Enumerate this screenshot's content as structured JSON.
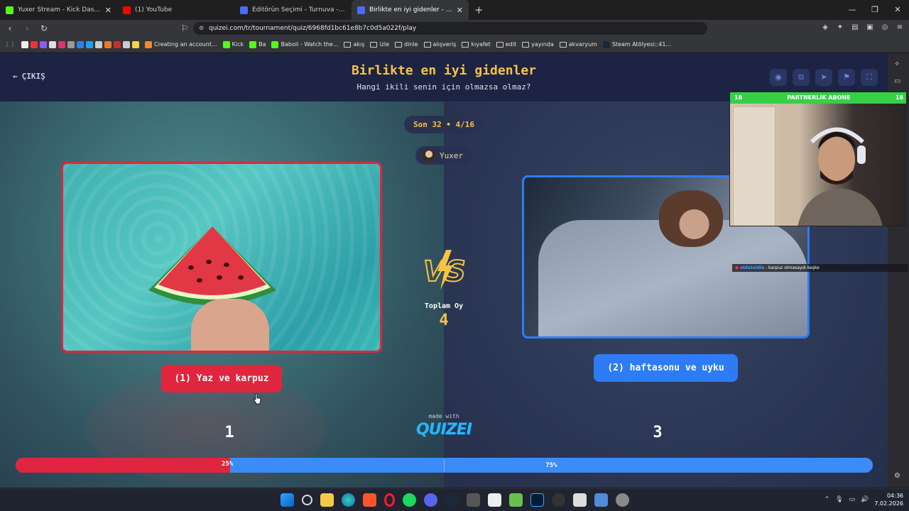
{
  "browser": {
    "tabs": [
      {
        "title": "Yuxer Stream - Kick Dashboard",
        "color": "#53fc18"
      },
      {
        "title": "(1) YouTube",
        "color": "#ff0000"
      },
      {
        "title": "Editörün Seçimi - Turnuva - Quizei",
        "color": "#4a6cf7"
      },
      {
        "title": "Birlikte en iyi gidenler - Tier List...",
        "color": "#4a6cf7",
        "active": true
      }
    ],
    "url": "quizei.com/tr/tournament/quiz/6968fd1bc61e8b7c0d5a022f/play",
    "bookmarks": [
      "Creating an account...",
      "Kick",
      "Ba",
      "Baboli - Watch the...",
      "akış",
      "izle",
      "dinle",
      "alışveriş",
      "kıyafet",
      "edit",
      "yayında",
      "akvaryum",
      "Steam Atölyesi::41..."
    ]
  },
  "quiz": {
    "exit_label": "ÇIKIŞ",
    "title": "Birlikte en iyi gidenler",
    "subtitle": "Hangi ikili senin için olmazsa olmaz?",
    "round": "Son 32 • 4/16",
    "creator": "Yuxer",
    "vs_label": "VS",
    "total_label": "Toplam Oy",
    "total_value": "4",
    "made_with": "made with",
    "brand": "QUIZEI",
    "left": {
      "label": "(1) Yaz ve karpuz",
      "votes": "1",
      "percent_label": "25%",
      "percent": 25,
      "color": "#e0263e"
    },
    "right": {
      "label": "(2) haftasonu ve uyku",
      "votes": "3",
      "percent_label": "75%",
      "percent": 75,
      "color": "#2d7cf6"
    }
  },
  "overlay": {
    "banner": "PARTNERLIK ABONE",
    "banner_num_left": "18",
    "banner_num_right": "18",
    "chat_user": "oldatoidle",
    "chat_text": ": karpuz olmasaydı keşke"
  },
  "taskbar": {
    "time": "04:36",
    "date": "7.02.2026"
  }
}
